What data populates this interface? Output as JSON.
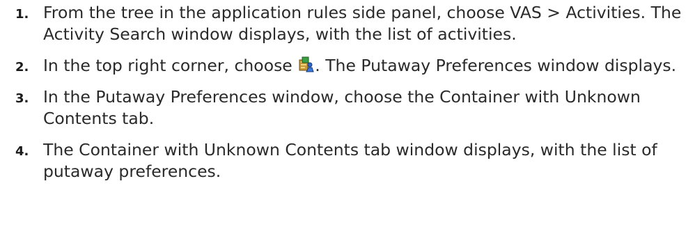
{
  "steps": [
    {
      "number": "1.",
      "text": "From the tree in the application rules side panel, choose VAS > Activities. The Activity Search window displays, with the list of activities."
    },
    {
      "number": "2.",
      "text_before_icon": "In the top right corner, choose ",
      "icon": "putaway-preferences-icon",
      "text_after_icon": ". The Putaway Preferences window displays."
    },
    {
      "number": "3.",
      "text": "In the Putaway Preferences window, choose the Container with Unknown Contents tab."
    },
    {
      "number": "4.",
      "text": "The Container with Unknown Contents tab window displays, with the list of putaway preferences."
    }
  ]
}
